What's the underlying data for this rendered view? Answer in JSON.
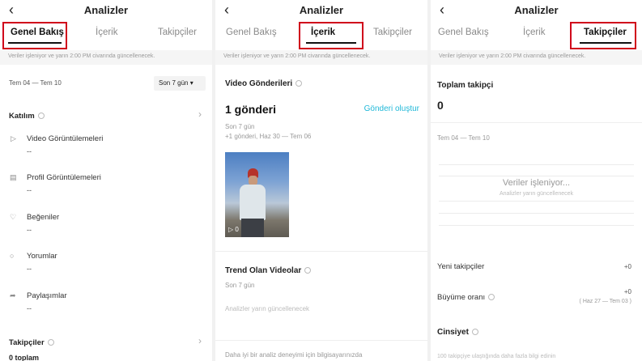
{
  "screen_title": "Analizler",
  "tabs": [
    "Genel Bakış",
    "İçerik",
    "Takipçiler"
  ],
  "notice": "Veriler işleniyor ve yarın 2:00 PM civarında güncellenecek.",
  "overview": {
    "date_range": "Tem 04 — Tem 10",
    "period_select": "Son 7 gün",
    "engagement_title": "Katılım",
    "metrics": [
      {
        "label": "Video Görüntülemeleri",
        "value": "--",
        "icon": "play-icon"
      },
      {
        "label": "Profil Görüntülemeleri",
        "value": "--",
        "icon": "profile-icon"
      },
      {
        "label": "Beğeniler",
        "value": "--",
        "icon": "heart-icon"
      },
      {
        "label": "Yorumlar",
        "value": "--",
        "icon": "comment-icon"
      },
      {
        "label": "Paylaşımlar",
        "value": "--",
        "icon": "share-icon"
      }
    ],
    "followers_title": "Takipçiler",
    "followers_total": "0 toplam"
  },
  "content": {
    "video_posts_title": "Video Gönderileri",
    "posts_count": "1 gönderi",
    "create_post": "Gönderi oluştur",
    "period": "Son 7 gün",
    "posts_sub": "+1 gönderi, Haz 30 — Tem 06",
    "thumb_views": "0",
    "trending_title": "Trend Olan Videolar",
    "trending_period": "Son 7 gün",
    "trending_empty": "Analizler yarın güncellenecek",
    "footer": "Daha iyi bir analiz deneyimi için bilgisayarınızda"
  },
  "followers": {
    "total_title": "Toplam takipçi",
    "total_value": "0",
    "date_range": "Tem 04 — Tem 10",
    "processing": "Veriler işleniyor...",
    "processing_sub": "Analizler yarın güncellenecek",
    "new_followers": "Yeni takipçiler",
    "new_followers_value": "+0",
    "growth_rate": "Büyüme oranı",
    "growth_value": "+0",
    "growth_range": "( Haz 27 — Tem 03 )",
    "gender": "Cinsiyet",
    "gender_note": "100 takipçiye ulaştığında daha fazla bilgi edinin"
  },
  "accent_color": "#20b8d8",
  "highlight_color": "#d0021b"
}
